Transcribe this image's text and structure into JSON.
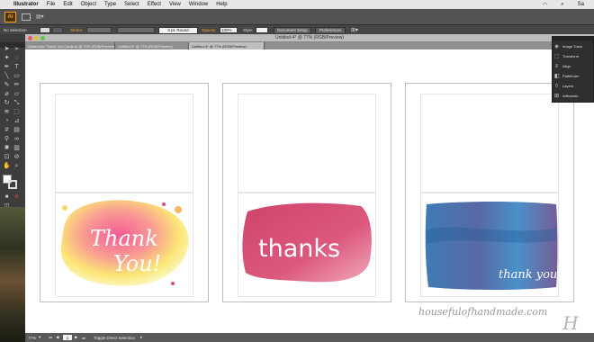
{
  "menubar": {
    "apple_icon": "apple-icon",
    "app_name": "Illustrator",
    "items": [
      "File",
      "Edit",
      "Object",
      "Type",
      "Select",
      "Effect",
      "View",
      "Window",
      "Help"
    ],
    "right_text": "Sa"
  },
  "appbar": {
    "logo_text": "Ai",
    "arrange_label": "▤▾"
  },
  "control_bar": {
    "selection": "No Selection",
    "stroke_label": "Stroke:",
    "brush_label": "5 pt. Round",
    "opacity_label": "Opacity:",
    "opacity_value": "100%",
    "style_label": "Style:",
    "document_setup": "Document Setup",
    "preferences": "Preferences"
  },
  "window": {
    "title": "Untitled-4* @ 77% (RGB/Preview)",
    "accent": "#f7a21b"
  },
  "tabs": [
    {
      "label": "Watercolor Thank You Cards.ai @ 74% (RGB/Preview)",
      "active": false
    },
    {
      "label": "Untitled-2* @ 77% (RGB/Preview)",
      "active": false
    },
    {
      "label": "Untitled-4* @ 77% (RGB/Preview)",
      "active": true
    }
  ],
  "cards": [
    {
      "text": "Thank You!",
      "style": "warm-watercolor"
    },
    {
      "text": "thanks",
      "style": "pink-watercolor"
    },
    {
      "text": "thank you",
      "style": "blue-watercolor"
    }
  ],
  "panel": {
    "items": [
      {
        "label": "Image Trace",
        "icon": "image-trace-icon"
      },
      {
        "label": "Transform",
        "icon": "transform-icon"
      },
      {
        "label": "Align",
        "icon": "align-icon"
      },
      {
        "label": "Pathfinder",
        "icon": "pathfinder-icon"
      },
      {
        "label": "Layers",
        "icon": "layers-icon"
      },
      {
        "label": "Artboards",
        "icon": "artboards-icon"
      }
    ]
  },
  "status_bar": {
    "zoom": "77%",
    "artboard_number": "1",
    "tool_label": "Toggle Direct Selection"
  },
  "watermark": {
    "text": "housefulofhandmade.com",
    "logo": "H"
  }
}
